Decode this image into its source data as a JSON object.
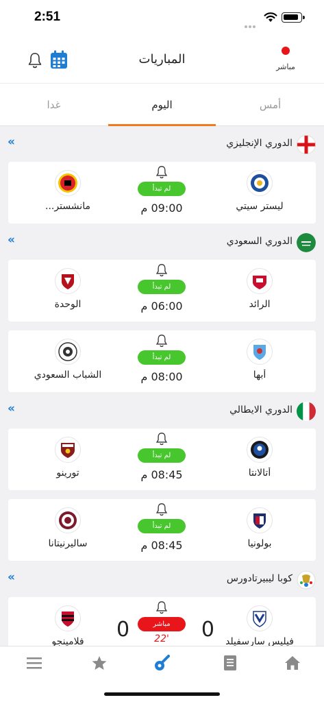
{
  "status_bar": {
    "time": "2:51"
  },
  "header": {
    "title": "المباريات",
    "live_label": "مباشر",
    "live_color": "#e8151b",
    "accent_color": "#1f7ed3"
  },
  "tabs": [
    {
      "label": "أمس",
      "active": false
    },
    {
      "label": "اليوم",
      "active": true
    },
    {
      "label": "غدا",
      "active": false
    }
  ],
  "leagues": [
    {
      "name": "الدوري الإنجليزي",
      "flag": "england-flag",
      "matches": [
        {
          "home": "ليستر سيتي",
          "away": "مانشستر...",
          "home_logo": "leicester-logo",
          "away_logo": "man-united-logo",
          "status": "لم تبدأ",
          "time": "09:00 م"
        }
      ]
    },
    {
      "name": "الدوري السعودي",
      "flag": "saudi-flag",
      "matches": [
        {
          "home": "الرائد",
          "away": "الوحدة",
          "home_logo": "alraed-logo",
          "away_logo": "alwehda-logo",
          "status": "لم تبدأ",
          "time": "06:00 م"
        },
        {
          "home": "أبها",
          "away": "الشباب السعودي",
          "home_logo": "abha-logo",
          "away_logo": "alshabab-logo",
          "status": "لم تبدأ",
          "time": "08:00 م"
        }
      ]
    },
    {
      "name": "الدوري الايطالي",
      "flag": "italy-flag",
      "matches": [
        {
          "home": "أتالانتا",
          "away": "تورينو",
          "home_logo": "atalanta-logo",
          "away_logo": "torino-logo",
          "status": "لم تبدأ",
          "time": "08:45 م"
        },
        {
          "home": "بولونيا",
          "away": "ساليرنيتانا",
          "home_logo": "bologna-logo",
          "away_logo": "salernitana-logo",
          "status": "لم تبدأ",
          "time": "08:45 م"
        }
      ]
    },
    {
      "name": "كوبا ليبيرتادورس",
      "flag": "libertadores-logo",
      "matches": [
        {
          "home": "فيليس سارسفيلد",
          "away": "فلامينجو",
          "home_logo": "velez-logo",
          "away_logo": "flamengo-logo",
          "status": "مباشر",
          "home_score": "0",
          "away_score": "0",
          "minute": "22'"
        }
      ]
    }
  ],
  "bottom_nav": [
    "menu-icon",
    "star-icon",
    "whistle-icon",
    "news-icon",
    "home-icon"
  ],
  "colors": {
    "not_started": "#47c62e",
    "live": "#e8151b",
    "tab_underline": "#f07a1f",
    "active_nav": "#1f7ed3",
    "inactive_nav": "#8a8a8a"
  }
}
